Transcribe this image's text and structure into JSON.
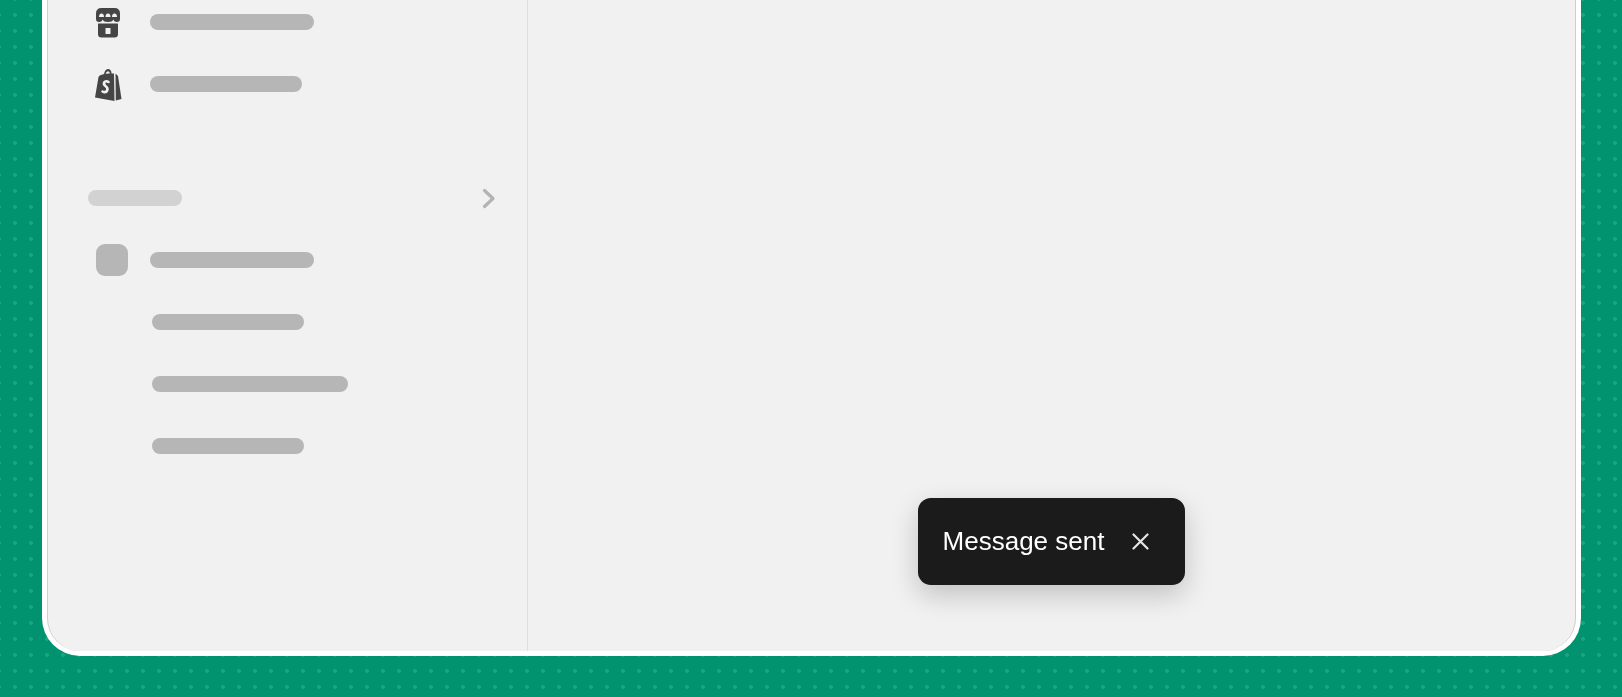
{
  "sidebar": {
    "items": [
      {
        "kind": "store"
      },
      {
        "kind": "bag"
      },
      {
        "kind": "heading"
      },
      {
        "kind": "avatar"
      },
      {
        "kind": "sub"
      },
      {
        "kind": "sub"
      },
      {
        "kind": "sub"
      }
    ]
  },
  "toast": {
    "message": "Message sent"
  }
}
